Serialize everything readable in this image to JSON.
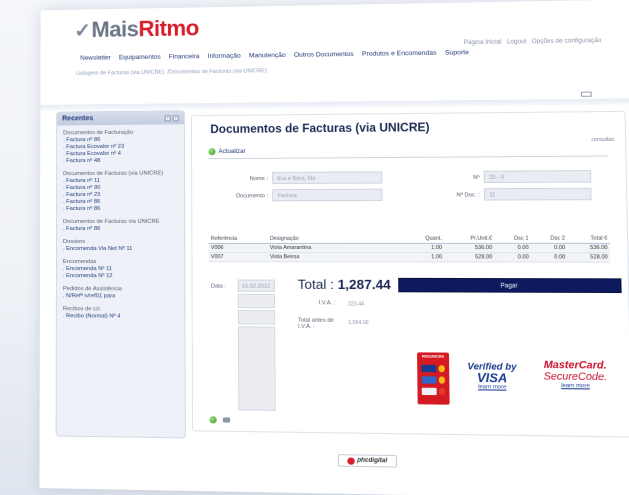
{
  "brand": {
    "prefix": "Mais",
    "accent": "Ritmo",
    "accent_color": "#d81e2a"
  },
  "util_links": [
    "Página Inicial",
    "Logout",
    "Opções de configuração"
  ],
  "nav": [
    "Newsletter",
    "Equipamentos",
    "Financeira",
    "Informação",
    "Manutenção",
    "Outros Documentos",
    "Produtos e Encomendas",
    "Suporte"
  ],
  "breadcrumb": [
    "Listagem de Facturas (via UNICRE)",
    "/Documentos de Facturas (via UNICRE)"
  ],
  "sidebar": {
    "title": "Recentes",
    "groups": [
      {
        "title": "Documentos de Facturação",
        "items": [
          ". Factura nº 86",
          ". Factura Ecovalor nº 23",
          ". Factura Ecovalor nº 4",
          ". Factura nº 48"
        ]
      },
      {
        "title": "Documentos de Facturas (via UNICRE)",
        "items": [
          ". Factura nº 11",
          ". Factura nº 90",
          ". Factura nº 23",
          ". Factura nº 86",
          ". Factura nº 86"
        ]
      },
      {
        "title": "Documentos de Facturas via UNICRE",
        "items": [
          ". Factura nº 86"
        ]
      },
      {
        "title": "Dossiers",
        "items": [
          ". Encomenda Via Net Nº 11"
        ]
      },
      {
        "title": "Encomendas",
        "items": [
          ". Encomenda Nº 11",
          ". Encomenda Nº 12"
        ]
      },
      {
        "title": "Pedidos de Assistência",
        "items": [
          ". N/Refª n/ref01 para"
        ]
      },
      {
        "title": "Recibos de c/c",
        "items": [
          ". Recibo (Normal) Nº 4"
        ]
      }
    ]
  },
  "main": {
    "title": "Documentos de Facturas (via UNICRE)",
    "consult": "consultas",
    "refresh": "Actualizar",
    "fields": {
      "nome_label": "Nome :",
      "nome_value": "Era e Bera, lda",
      "documento_label": "Documento :",
      "documento_value": "Factura",
      "numero_label": "Nº",
      "numero_value": "20 - 0",
      "numero_doc_label": "Nº Doc. :",
      "numero_doc_value": "11"
    },
    "table": {
      "headers": [
        "Referência",
        "Designação",
        "Quant.",
        "Pr.Unit.€",
        "Dsc 1",
        "Dsc 2",
        "Total €"
      ],
      "rows": [
        [
          "V006",
          "Viola Amarantina",
          "1.00",
          "536.00",
          "0.00",
          "0.00",
          "536.00"
        ],
        [
          "V007",
          "Viola Beiroa",
          "1.00",
          "528.00",
          "0.00",
          "0.00",
          "528.00"
        ]
      ]
    },
    "date_label": "Data :",
    "date_value": "15.02.2012",
    "total_label": "Total :",
    "total_value": "1,287.44",
    "pay_label": "Pagar",
    "iva_label": "I.V.A. :",
    "iva_value": "223.44",
    "total_antes_label": "Total antes de I.V.A. :",
    "total_antes_value": "1,064.00"
  },
  "payment": {
    "redunicre": "REDUNICRE",
    "vbv_line1": "Verified by",
    "vbv_line2": "VISA",
    "vbv_learn": "learn more",
    "mc_line1": "MasterCard.",
    "mc_line2": "SecureCode.",
    "mc_learn": "learn more"
  },
  "footer": {
    "brand": "phcdigital"
  }
}
